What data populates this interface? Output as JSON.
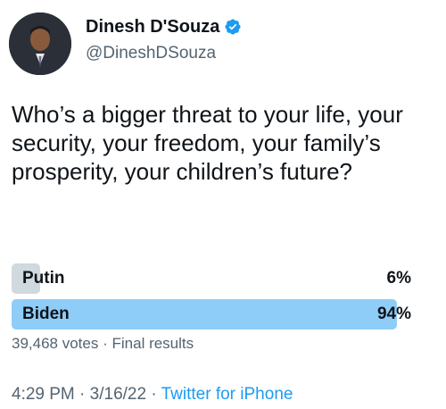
{
  "author": {
    "display_name": "Dinesh D'Souza",
    "handle": "@DineshDSouza",
    "verified": true,
    "verified_icon": "verified-badge-icon",
    "verified_color": "#1d9bf0"
  },
  "tweet": {
    "text": "Who’s a bigger threat to your life, your security, your freedom, your family’s prosperity, your children’s future?"
  },
  "poll": {
    "options": [
      {
        "label": "Putin",
        "percent_text": "6%",
        "fraction": 0.06,
        "winner": false
      },
      {
        "label": "Biden",
        "percent_text": "94%",
        "fraction": 0.94,
        "winner": true
      }
    ],
    "votes": "39,468 votes",
    "separator": "·",
    "status": "Final results",
    "colors": {
      "winner": "#8ecdf8",
      "other": "#cfd9de"
    }
  },
  "meta": {
    "time": "4:29 PM",
    "date": "3/16/22",
    "separator": "·",
    "source": "Twitter for iPhone"
  }
}
